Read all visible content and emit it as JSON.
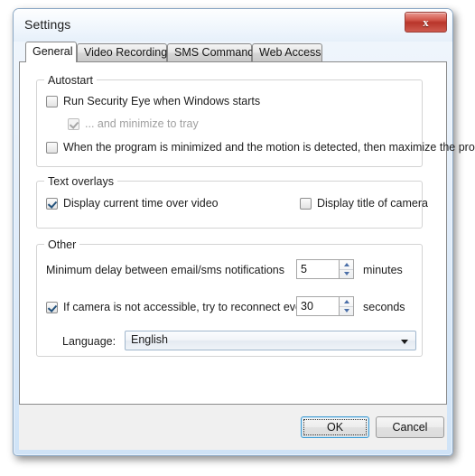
{
  "window": {
    "title": "Settings",
    "close_glyph": "x"
  },
  "tabs": [
    {
      "label": "General",
      "active": true
    },
    {
      "label": "Video Recording",
      "active": false
    },
    {
      "label": "SMS Commands",
      "active": false
    },
    {
      "label": "Web Access",
      "active": false
    }
  ],
  "autostart": {
    "group_title": "Autostart",
    "run_on_windows_start": {
      "label": "Run Security Eye when Windows starts",
      "checked": false,
      "enabled": true
    },
    "minimize_to_tray": {
      "label": "... and minimize to tray",
      "checked": true,
      "enabled": false
    },
    "maximize_on_motion": {
      "label": "When the program is minimized and the motion is detected, then maximize the program",
      "checked": false,
      "enabled": true
    }
  },
  "text_overlays": {
    "group_title": "Text overlays",
    "display_current_time": {
      "label": "Display current time over video",
      "checked": true,
      "enabled": true
    },
    "display_camera_title": {
      "label": "Display title of camera",
      "checked": false,
      "enabled": true
    }
  },
  "other": {
    "group_title": "Other",
    "min_delay": {
      "label": "Minimum delay between email/sms notifications",
      "value": "5",
      "unit": "minutes"
    },
    "reconnect": {
      "label": "If camera is not accessible, try to reconnect every",
      "checked": true,
      "value": "30",
      "unit": "seconds"
    },
    "language": {
      "label": "Language:",
      "selected": "English"
    }
  },
  "footer": {
    "ok_label": "OK",
    "cancel_label": "Cancel"
  },
  "colors": {
    "close_button_red": "#b8352a",
    "focus_blue": "#3c9ad2",
    "spinner_arrow_blue": "#4b6fa8",
    "disabled_text": "#a0a0a0"
  }
}
